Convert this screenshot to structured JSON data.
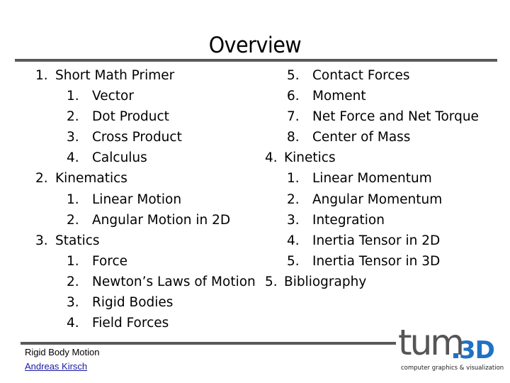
{
  "slide": {
    "title": "Overview",
    "left_column": [
      {
        "level": 1,
        "num": "1.",
        "label": "Short Math Primer"
      },
      {
        "level": 2,
        "num": "1.",
        "label": "Vector"
      },
      {
        "level": 2,
        "num": "2.",
        "label": "Dot Product"
      },
      {
        "level": 2,
        "num": "3.",
        "label": "Cross Product"
      },
      {
        "level": 2,
        "num": "4.",
        "label": "Calculus"
      },
      {
        "level": 1,
        "num": "2.",
        "label": "Kinematics"
      },
      {
        "level": 2,
        "num": "1.",
        "label": "Linear Motion"
      },
      {
        "level": 2,
        "num": "2.",
        "label": "Angular Motion in 2D"
      },
      {
        "level": 1,
        "num": "3.",
        "label": "Statics"
      },
      {
        "level": 2,
        "num": "1.",
        "label": "Force"
      },
      {
        "level": 2,
        "num": "2.",
        "label": "Newton’s Laws of Motion"
      },
      {
        "level": 2,
        "num": "3.",
        "label": "Rigid Bodies"
      },
      {
        "level": 2,
        "num": "4.",
        "label": "Field Forces"
      }
    ],
    "right_column": [
      {
        "level": 2,
        "num": "5.",
        "label": "Contact Forces"
      },
      {
        "level": 2,
        "num": "6.",
        "label": "Moment"
      },
      {
        "level": 2,
        "num": "7.",
        "label": "Net Force and Net Torque"
      },
      {
        "level": 2,
        "num": "8.",
        "label": "Center of Mass"
      },
      {
        "level": 1,
        "num": "4.",
        "label": "Kinetics"
      },
      {
        "level": 2,
        "num": "1.",
        "label": "Linear Momentum"
      },
      {
        "level": 2,
        "num": "2.",
        "label": "Angular Momentum"
      },
      {
        "level": 2,
        "num": "3.",
        "label": "Integration"
      },
      {
        "level": 2,
        "num": "4.",
        "label": "Inertia Tensor in 2D"
      },
      {
        "level": 2,
        "num": "5.",
        "label": "Inertia Tensor in 3D"
      },
      {
        "level": 1,
        "num": "5.",
        "label": "Bibliography"
      }
    ]
  },
  "footer": {
    "course_title": "Rigid Body Motion",
    "author": "Andreas Kirsch",
    "logo": {
      "main": "tum",
      "suffix": "3D",
      "tagline": "computer graphics & visualization",
      "brand_color": "#1f72c4",
      "gray_color": "#555555"
    }
  }
}
